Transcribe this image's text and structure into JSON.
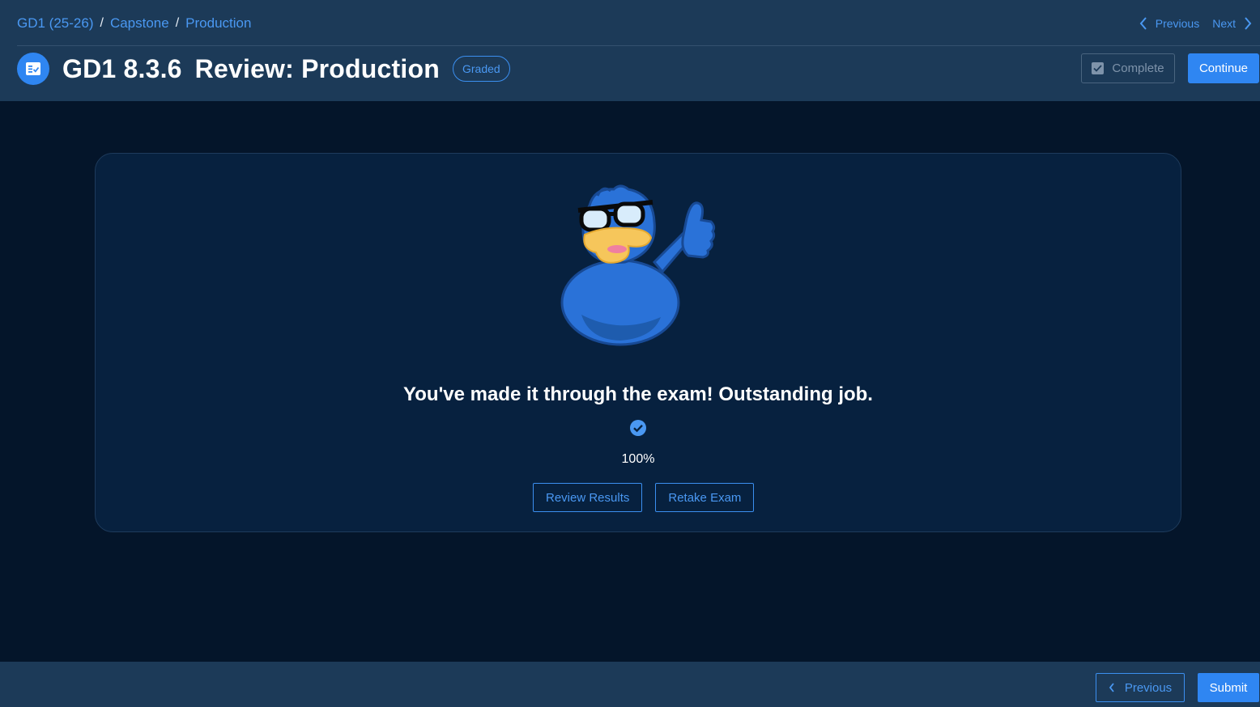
{
  "breadcrumb": {
    "items": [
      "GD1 (25-26)",
      "Capstone",
      "Production"
    ],
    "separator": "/"
  },
  "topnav": {
    "previous_label": "Previous",
    "next_label": "Next"
  },
  "header": {
    "code": "GD1 8.3.6",
    "title": "Review: Production",
    "badge": "Graded",
    "complete_label": "Complete",
    "continue_label": "Continue"
  },
  "result": {
    "message": "You've made it through the exam! Outstanding job.",
    "score": "100%",
    "review_label": "Review Results",
    "retake_label": "Retake Exam"
  },
  "footer": {
    "previous_label": "Previous",
    "submit_label": "Submit"
  },
  "icons": {
    "title": "assignment-check-icon",
    "prev": "chevron-left-icon",
    "next": "chevron-right-icon",
    "complete": "checkbox-icon",
    "score_status": "check-circle-icon",
    "mascot": "duck-mascot"
  },
  "colors": {
    "accent": "#2f86f2",
    "header_bg": "#1c3a58",
    "page_bg": "#04152a",
    "card_bg": "#07213f"
  }
}
